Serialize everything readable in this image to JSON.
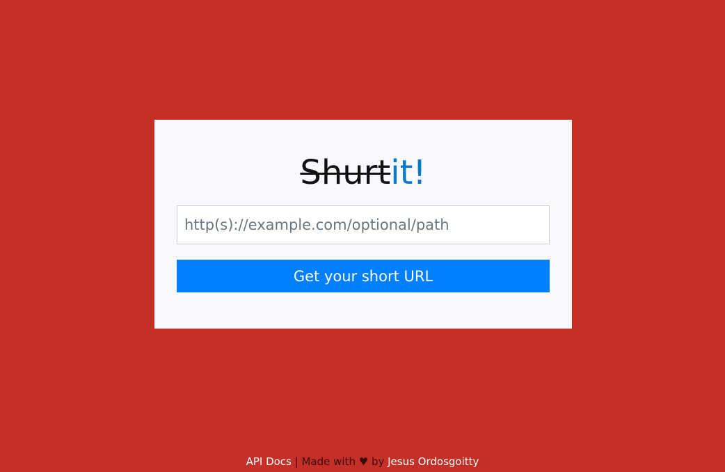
{
  "logo": {
    "part1": "Shurt",
    "part2": "it!"
  },
  "form": {
    "url_placeholder": "http(s)://example.com/optional/path",
    "url_value": "",
    "submit_label": "Get your short URL"
  },
  "footer": {
    "api_docs_link": "API Docs",
    "separator": " | ",
    "made_with": "Made with ",
    "heart": "♥",
    "by": " by ",
    "author_link": "Jesus Ordosgoitty"
  },
  "colors": {
    "background": "#c42f27",
    "card": "#f8f8fd",
    "accent": "#0a79c8",
    "button": "#0080ff"
  }
}
